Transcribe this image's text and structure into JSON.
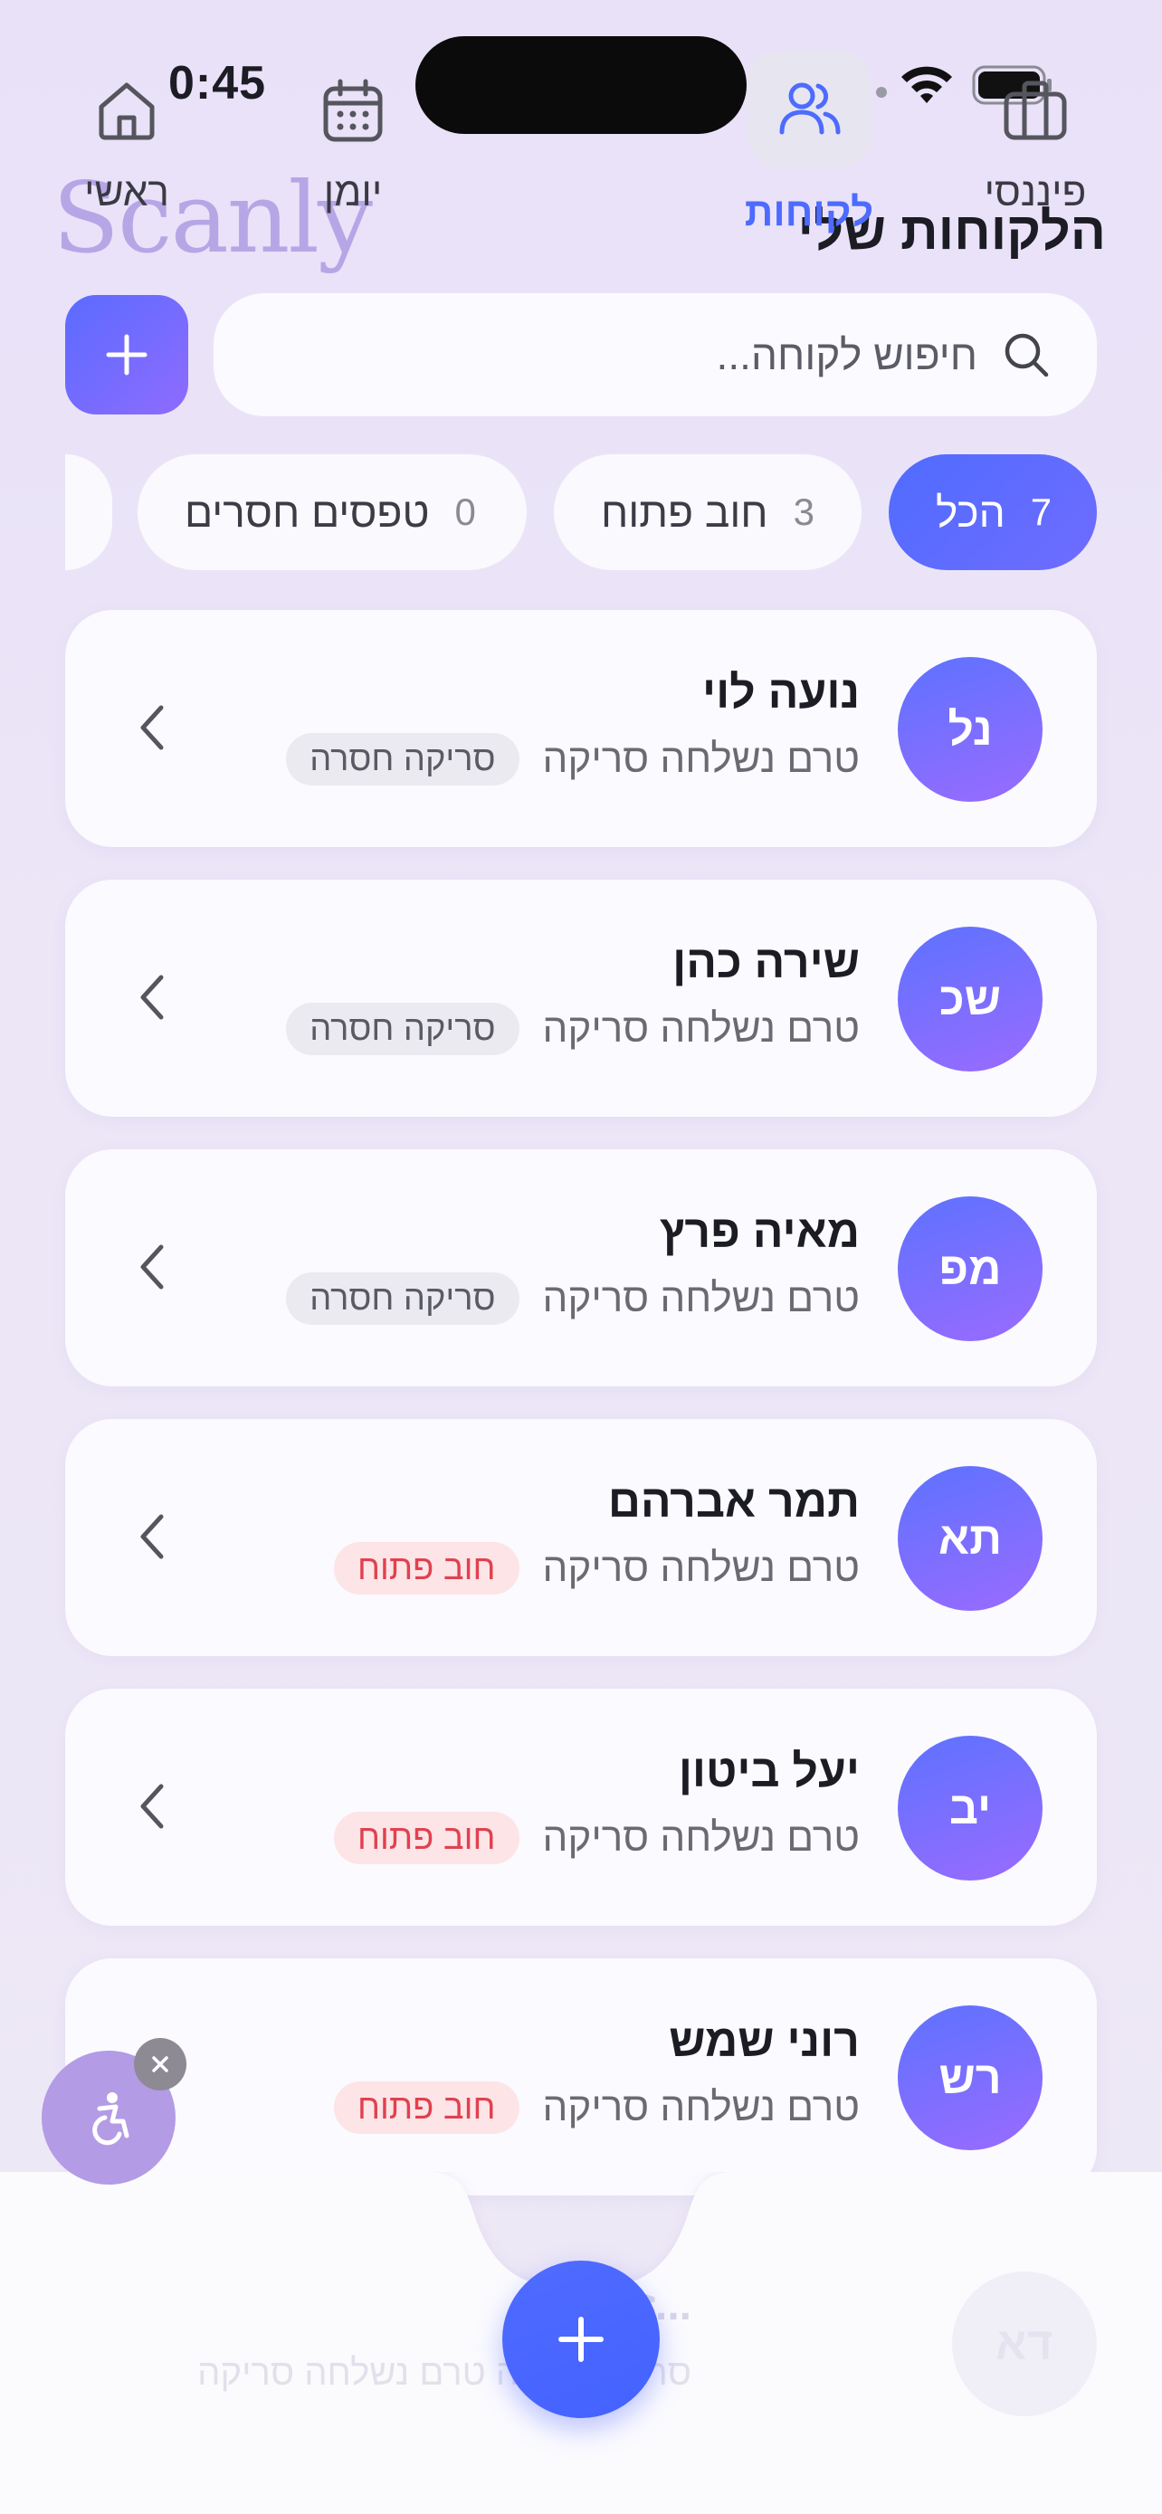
{
  "status_bar": {
    "time": "0:45"
  },
  "header": {
    "logo": "Scanly",
    "title": "הלקוחות שלי"
  },
  "search": {
    "placeholder": "חיפוש לקוחה..."
  },
  "filters": [
    {
      "label": "הכל",
      "count": "7",
      "active": true
    },
    {
      "label": "חוב פתוח",
      "count": "3",
      "active": false
    },
    {
      "label": "טפסים חסרים",
      "count": "0",
      "active": false
    }
  ],
  "clients": [
    {
      "initials": "נל",
      "name": "נועה לוי",
      "badge": "סריקה חסרה",
      "badge_type": "gray",
      "status": "טרם נשלחה סריקה"
    },
    {
      "initials": "שכ",
      "name": "שירה כהן",
      "badge": "סריקה חסרה",
      "badge_type": "gray",
      "status": "טרם נשלחה סריקה"
    },
    {
      "initials": "מפ",
      "name": "מאיה פרץ",
      "badge": "סריקה חסרה",
      "badge_type": "gray",
      "status": "טרם נשלחה סריקה"
    },
    {
      "initials": "תא",
      "name": "תמר אברהם",
      "badge": "חוב פתוח",
      "badge_type": "red",
      "status": "טרם נשלחה סריקה"
    },
    {
      "initials": "יב",
      "name": "יעל ביטון",
      "badge": "חוב פתוח",
      "badge_type": "red",
      "status": "טרם נשלחה סריקה"
    },
    {
      "initials": "רש",
      "name": "רוני שמש",
      "badge": "חוב פתוח",
      "badge_type": "red",
      "status": "טרם נשלחה סריקה"
    }
  ],
  "partial_client": {
    "initials": "דא",
    "name": "...זולא",
    "status": "סריקה חסרה טרם נשלחה סריקה"
  },
  "tabbar": {
    "home": "ראשי",
    "calendar": "יומן",
    "clients": "לקוחות",
    "finance": "פיננסי"
  },
  "colors": {
    "accent": "#4d6bff",
    "accent_purple": "#8f6bff",
    "debt_red": "#e0414f"
  }
}
